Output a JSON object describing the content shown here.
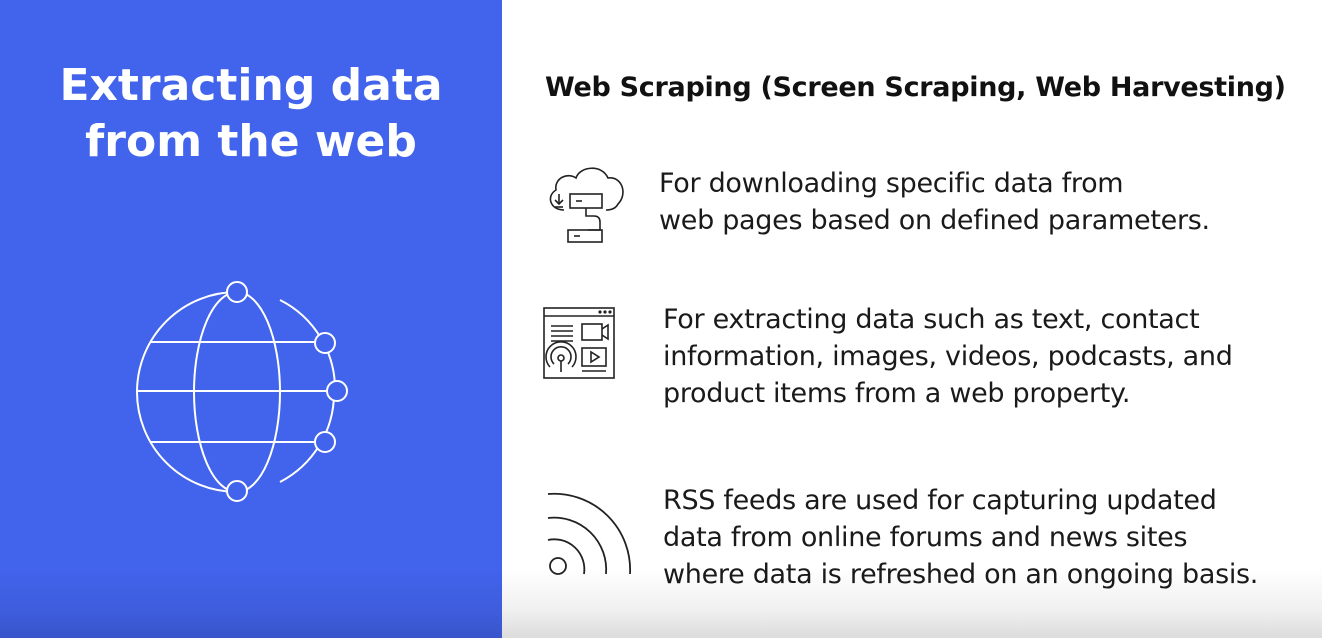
{
  "left": {
    "title_line1": "Extracting data",
    "title_line2": "from the web",
    "globe_icon": "globe-network-icon",
    "background_color": "#4263eb"
  },
  "right": {
    "heading": "Web Scraping (Screen Scraping, Web Harvesting)",
    "items": [
      {
        "icon": "cloud-download-icon",
        "lines": [
          "For downloading specific data from",
          "web pages based on defined parameters."
        ]
      },
      {
        "icon": "web-content-icon",
        "lines": [
          "For extracting data such as text, contact",
          "information, images, videos, podcasts, and",
          "product items from a web property."
        ]
      },
      {
        "icon": "rss-feed-icon",
        "lines": [
          "RSS feeds are used for capturing updated",
          "data from online forums and news sites",
          "where data is refreshed on an ongoing basis."
        ]
      }
    ]
  }
}
